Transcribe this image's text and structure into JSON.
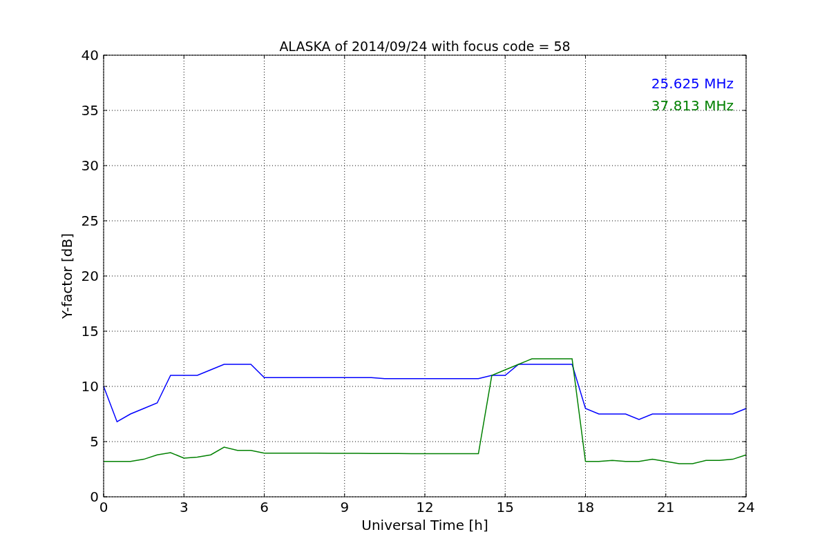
{
  "chart": {
    "chart_data": {
      "type": "line",
      "title": "ALASKA of 2014/09/24 with focus code = 58",
      "xlabel": "Universal Time [h]",
      "ylabel": "Y-factor [dB]",
      "x": [
        0,
        0.5,
        1,
        1.5,
        2,
        2.5,
        3,
        3.5,
        4,
        4.5,
        5,
        5.5,
        6,
        6.5,
        7,
        7.5,
        8,
        8.5,
        9,
        9.5,
        10,
        10.5,
        11,
        11.5,
        12,
        12.5,
        13,
        13.5,
        14,
        14.5,
        15,
        15.5,
        16,
        16.5,
        17,
        17.5,
        18,
        18.5,
        19,
        19.5,
        20,
        20.5,
        21,
        21.5,
        22,
        22.5,
        23,
        23.5,
        24
      ],
      "series": [
        {
          "name": "25.625 MHz",
          "color": "#0000ff",
          "values": [
            10,
            6.8,
            7.5,
            8,
            8.5,
            11,
            11,
            11,
            11.5,
            12,
            12,
            12,
            10.8,
            10.8,
            10.8,
            10.8,
            10.8,
            10.8,
            10.8,
            10.8,
            10.8,
            10.7,
            10.7,
            10.7,
            10.7,
            10.7,
            10.7,
            10.7,
            10.7,
            11,
            11,
            12,
            12,
            12,
            12,
            12,
            8,
            7.5,
            7.5,
            7.5,
            7,
            7.5,
            7.5,
            7.5,
            7.5,
            7.5,
            7.5,
            7.5,
            8
          ]
        },
        {
          "name": "37.813 MHz",
          "color": "#008000",
          "values": [
            3.2,
            3.2,
            3.2,
            3.4,
            3.8,
            4,
            3.5,
            3.6,
            3.8,
            4.5,
            4.2,
            4.2,
            3.95,
            3.95,
            3.95,
            3.95,
            3.95,
            3.93,
            3.93,
            3.93,
            3.92,
            3.92,
            3.92,
            3.9,
            3.9,
            3.9,
            3.9,
            3.9,
            3.9,
            11,
            11.5,
            12,
            12.5,
            12.5,
            12.5,
            12.5,
            3.2,
            3.2,
            3.3,
            3.2,
            3.2,
            3.4,
            3.2,
            3,
            3,
            3.3,
            3.3,
            3.4,
            3.8
          ]
        }
      ],
      "grid": true,
      "xlim": [
        0,
        24
      ],
      "ylim": [
        0,
        40
      ],
      "xticks": [
        0,
        3,
        6,
        9,
        12,
        15,
        18,
        21,
        24
      ],
      "yticks": [
        0,
        5,
        10,
        15,
        20,
        25,
        30,
        35,
        40
      ]
    }
  }
}
